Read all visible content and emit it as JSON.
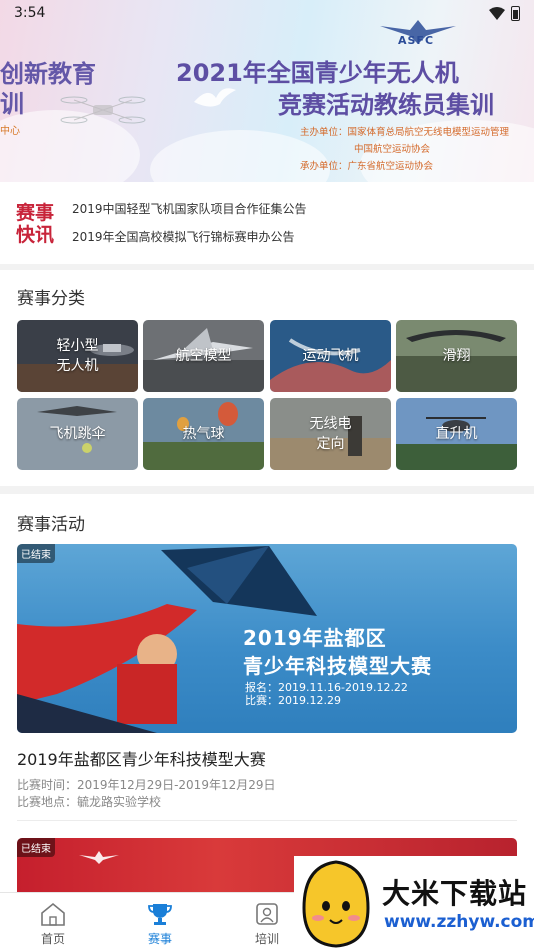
{
  "status_bar": {
    "time": "3:54"
  },
  "banner": {
    "logo_text": "ASFC",
    "left_line1": "创新教育",
    "left_line2": "训",
    "left_line3": "中心",
    "title_line1": "2021年全国青少年无人机",
    "title_line2": "竞赛活动教练员集训",
    "org_sponsor": "主办单位：国家体育总局航空无线电模型运动管理",
    "org_association": "中国航空运动协会",
    "org_organizer": "承办单位：广东省航空运动协会"
  },
  "news": {
    "logo_line1": "赛事",
    "logo_line2": "快讯",
    "items": [
      "2019中国轻型飞机国家队项目合作征集公告",
      "2019年全国高校模拟飞行锦标赛申办公告"
    ]
  },
  "categories": {
    "title": "赛事分类",
    "items": [
      {
        "line1": "轻小型",
        "line2": "无人机"
      },
      {
        "line1": "航空模型",
        "line2": ""
      },
      {
        "line1": "运动飞机",
        "line2": ""
      },
      {
        "line1": "滑翔",
        "line2": ""
      },
      {
        "line1": "飞机跳伞",
        "line2": ""
      },
      {
        "line1": "热气球",
        "line2": ""
      },
      {
        "line1": "无线电",
        "line2": "定向"
      },
      {
        "line1": "直升机",
        "line2": ""
      }
    ]
  },
  "activities": {
    "title": "赛事活动",
    "items": [
      {
        "tag": "已结束",
        "poster_line1": "2019年盐都区",
        "poster_line2": "青少年科技模型大赛",
        "poster_line3": "报名：2019.11.16-2019.12.22",
        "poster_line4": "比赛：2019.12.29",
        "title": "2019年盐都区青少年科技模型大赛",
        "time": "比赛时间：2019年12月29日-2019年12月29日",
        "location": "比赛地点：毓龙路实验学校"
      },
      {
        "tag": "已结束"
      }
    ]
  },
  "bottom_nav": {
    "items": [
      {
        "label": "首页"
      },
      {
        "label": "赛事"
      },
      {
        "label": "培训"
      }
    ]
  },
  "watermark": {
    "text": "大米下载站",
    "url": "www.zzhyw.com"
  }
}
